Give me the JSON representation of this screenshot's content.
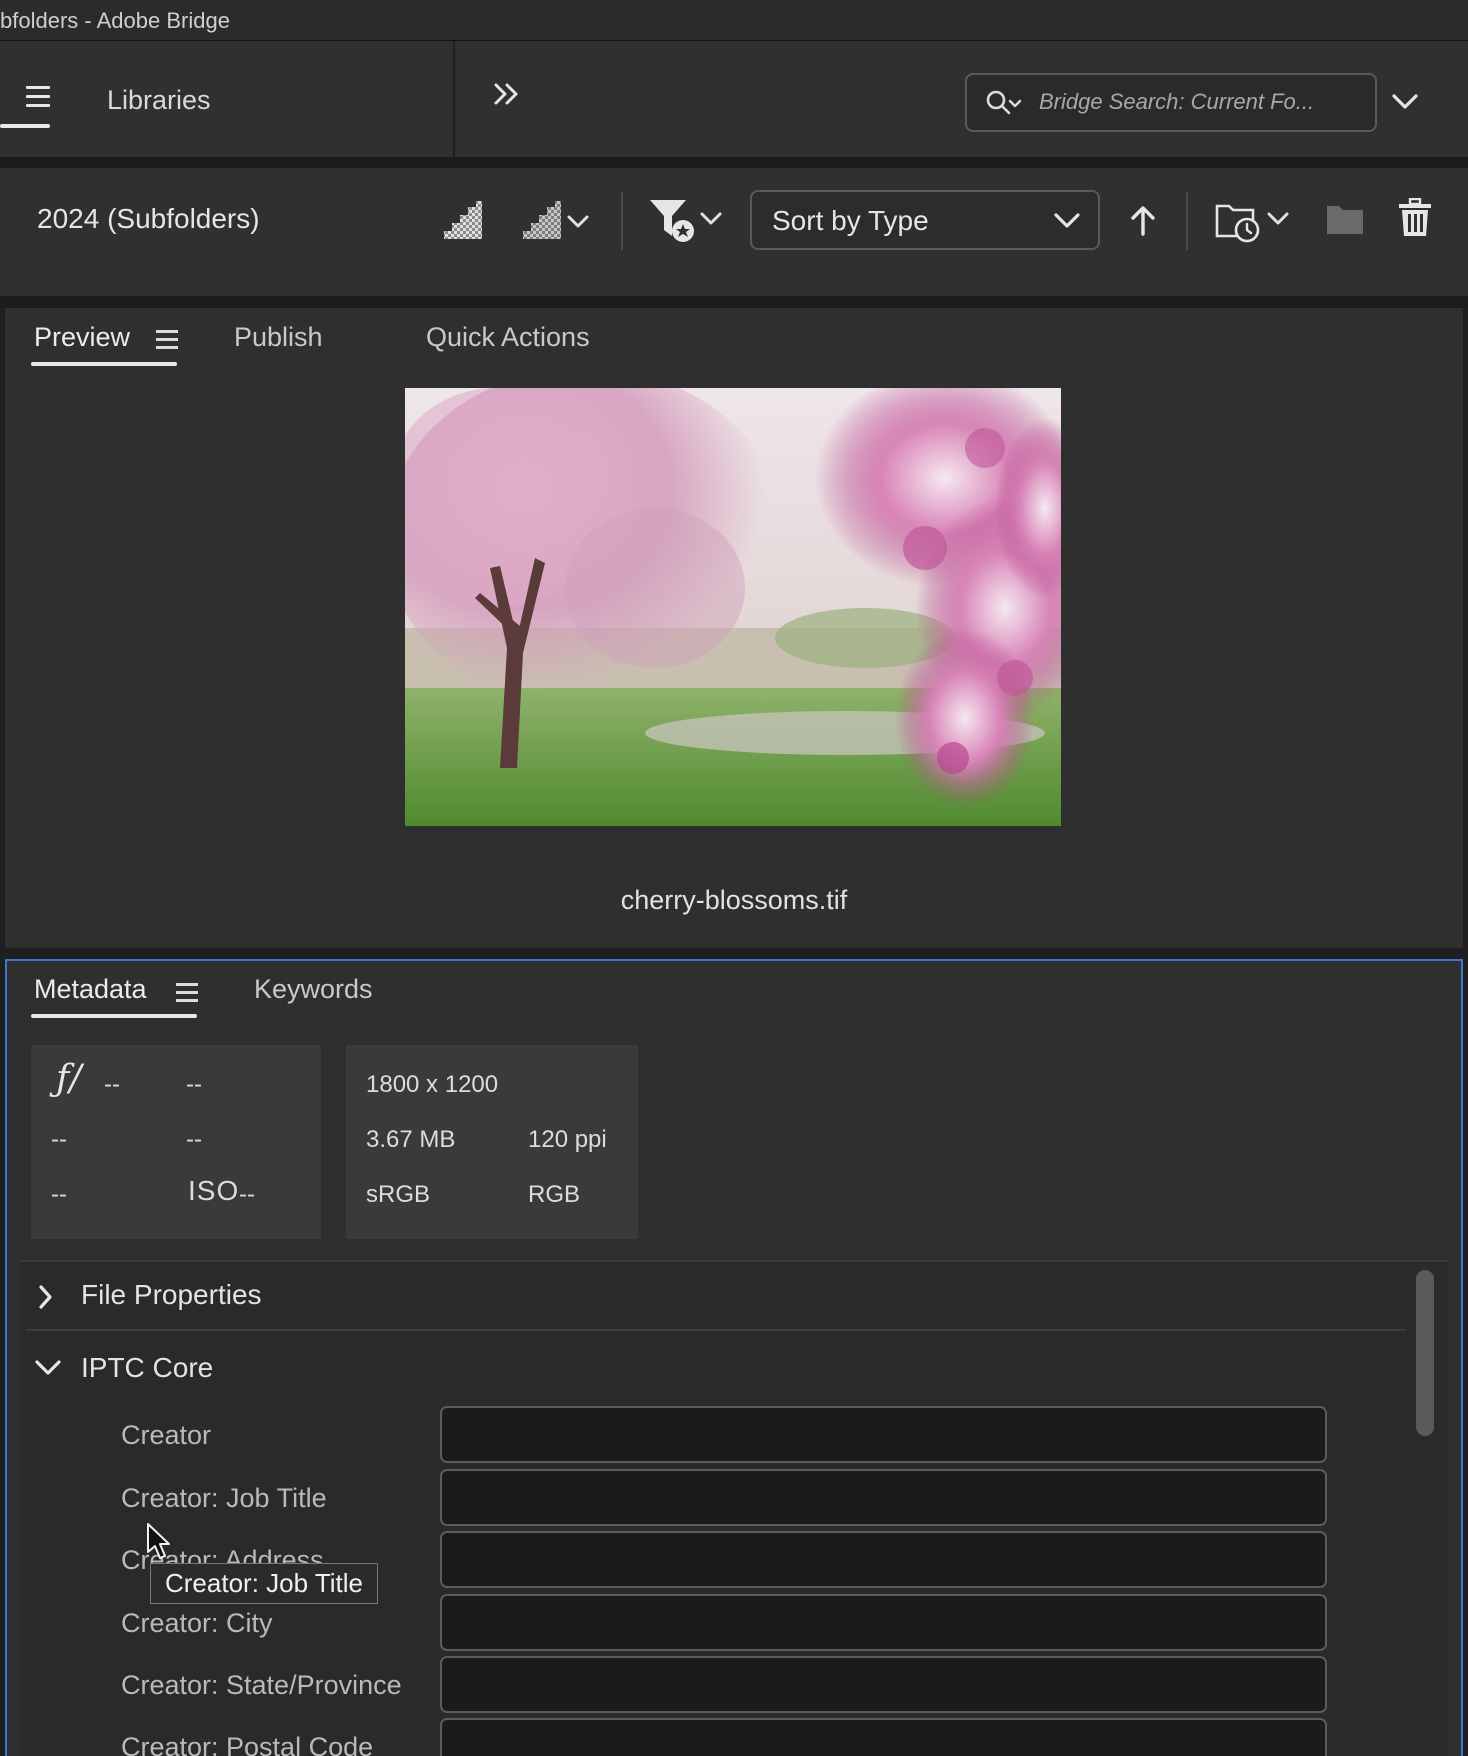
{
  "window": {
    "title": "bfolders - Adobe Bridge"
  },
  "header": {
    "libraries_label": "Libraries",
    "search": {
      "placeholder": "Bridge Search: Current Fo..."
    }
  },
  "toolbar": {
    "path_label": "2024 (Subfolders)",
    "sort": {
      "selected": "Sort by Type"
    }
  },
  "preview_panel": {
    "tabs": [
      {
        "label": "Preview",
        "active": true
      },
      {
        "label": "Publish",
        "active": false
      },
      {
        "label": "Quick Actions",
        "active": false
      }
    ],
    "filename": "cherry-blossoms.tif"
  },
  "metadata_panel": {
    "tabs": [
      {
        "label": "Metadata",
        "active": true
      },
      {
        "label": "Keywords",
        "active": false
      }
    ],
    "camera": {
      "fstop_symbol": "ƒ/",
      "fstop": "--",
      "shutter": "--",
      "row2_left": "--",
      "row2_right": "--",
      "row3_left": "--",
      "iso_label": "ISO",
      "iso": "--"
    },
    "file_info": {
      "dimensions": "1800 x 1200",
      "size": "3.67 MB",
      "resolution": "120 ppi",
      "color_profile": "sRGB",
      "color_mode": "RGB"
    },
    "sections": [
      {
        "label": "File Properties",
        "expanded": false
      },
      {
        "label": "IPTC Core",
        "expanded": true
      }
    ],
    "iptc_fields": [
      {
        "label": "Creator",
        "value": ""
      },
      {
        "label": "Creator: Job Title",
        "value": ""
      },
      {
        "label": "Creator: Address",
        "value": ""
      },
      {
        "label": "Creator: City",
        "value": ""
      },
      {
        "label": "Creator: State/Province",
        "value": ""
      },
      {
        "label": "Creator: Postal Code",
        "value": ""
      }
    ],
    "tooltip": "Creator: Job Title"
  },
  "colors": {
    "panel_bg": "#2f2f2f",
    "focus_border": "#3a78c8",
    "field_bg": "#1b1b1b"
  }
}
